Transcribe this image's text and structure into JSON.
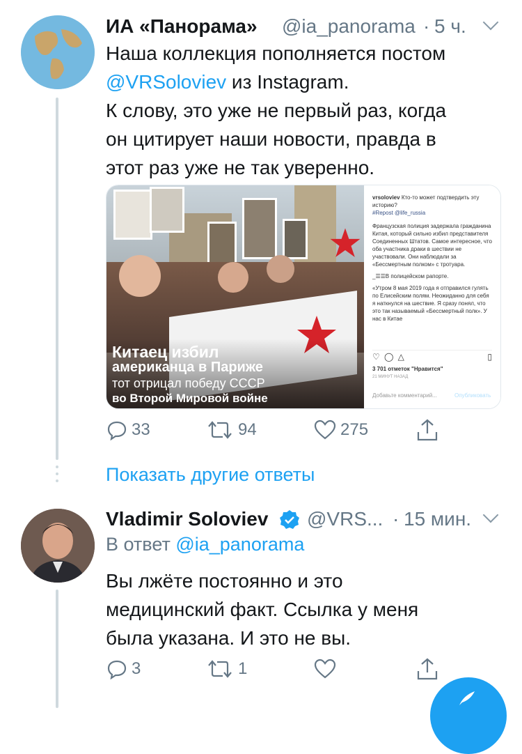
{
  "tweet1": {
    "name": "ИА «Панорама»",
    "handle": "@ia_panorama",
    "sep": "·",
    "time": "5 ч.",
    "text_line1": "Наша коллекция пополняется постом",
    "mention": "@VRSoloviev",
    "text_line2_rest": " из Instagram.",
    "text_line3": "К слову, это уже не первый раз, когда",
    "text_line4": "он цитирует наши новости, правда в",
    "text_line5": "этот раз уже не так уверенно.",
    "media": {
      "caption_1": "Китаец избил",
      "caption_2": "американца в Париже",
      "caption_3": "тот отрицал победу СССР",
      "caption_4": "во Второй Мировой войне",
      "insta_user": "vrsoloviev",
      "insta_text_1": "Кто-то может подтвердить эту историю?",
      "insta_text_2": "#Repost @life_russia",
      "insta_text_3": "Французская полиция задержала гражданина Китая, который сильно избил представителя Соединенных Штатов. Самое интересное, что оба участника драки в шествии не участвовали. Они наблюдали за «Бессмертным полком» с тротуара.",
      "insta_text_4": "_☰☰В полицейском рапорте.",
      "insta_text_5": "«Утром 8 мая 2019 года я отправился гулять по Елисейским полям. Неожиданно для себя я наткнулся на шествие. Я сразу понял, что это так называемый «Бессмертный полк». У нас в Китае",
      "insta_likes": "3 701 отметок \"Нравится\"",
      "insta_time": "21 МИНУТ НАЗАД",
      "insta_comment_placeholder": "Добавьте комментарий...",
      "insta_publish": "Опубликовать"
    },
    "replies": "33",
    "retweets": "94",
    "likes": "275"
  },
  "show_more": "Показать другие ответы",
  "tweet2": {
    "name": "Vladimir Soloviev",
    "handle": "@VRS...",
    "sep": "·",
    "time": "15 мин.",
    "reply_prefix": "В ответ ",
    "reply_to": "@ia_panorama",
    "text_line1": "Вы лжёте постоянно и это",
    "text_line2": "медицинский факт. Ссылка у меня",
    "text_line3": "была указана. И это не вы.",
    "replies": "3",
    "retweets": "1",
    "likes": ""
  },
  "colors": {
    "accent": "#1da1f2",
    "muted": "#657786",
    "text": "#14171a",
    "thread": "#cfd9de"
  }
}
